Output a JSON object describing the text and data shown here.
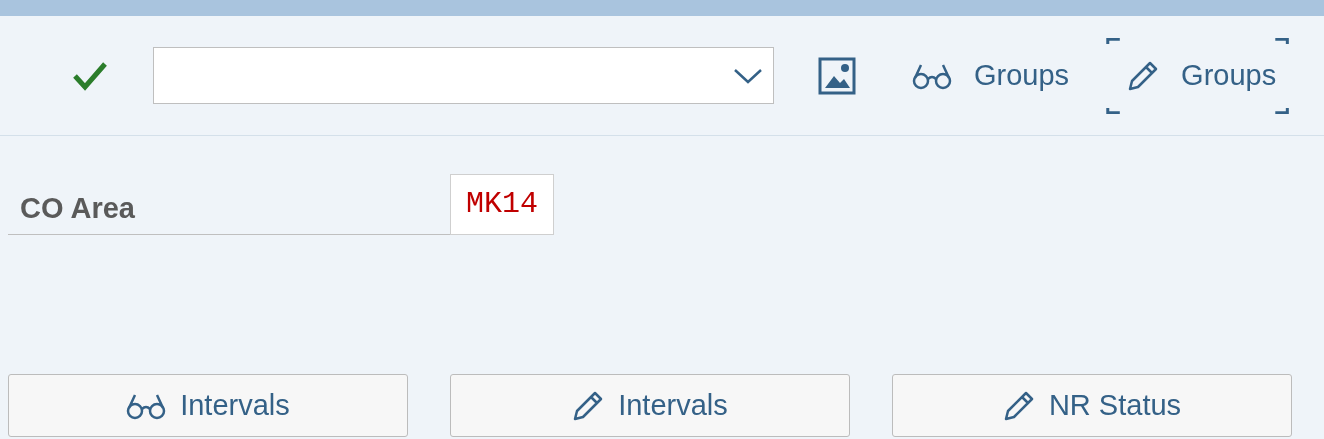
{
  "toolbar": {
    "buttons": [
      {
        "kind": "display",
        "label": "Groups",
        "focused": false
      },
      {
        "kind": "edit",
        "label": "Groups",
        "focused": true
      }
    ]
  },
  "form": {
    "fields": [
      {
        "label": "CO Area",
        "value": "MK14"
      }
    ]
  },
  "actions": [
    {
      "kind": "display",
      "label": "Intervals"
    },
    {
      "kind": "edit",
      "label": "Intervals"
    },
    {
      "kind": "edit",
      "label": "NR Status"
    }
  ]
}
